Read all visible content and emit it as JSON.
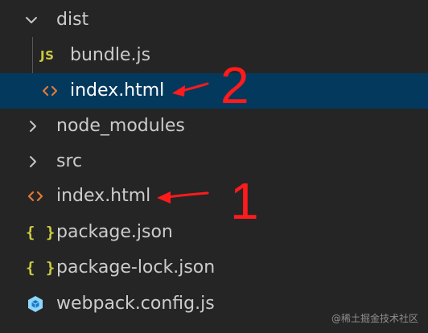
{
  "explorer": {
    "items": [
      {
        "label": "dist",
        "kind": "folder",
        "expanded": true,
        "icon": "chevron-down-icon"
      },
      {
        "label": "bundle.js",
        "kind": "file",
        "icon": "js-file-icon",
        "icon_text": "JS",
        "icon_color": "#cbcb41"
      },
      {
        "label": "index.html",
        "kind": "file",
        "icon": "html-file-icon",
        "icon_color": "#e37933",
        "selected": true
      },
      {
        "label": "node_modules",
        "kind": "folder",
        "expanded": false,
        "icon": "chevron-right-icon"
      },
      {
        "label": "src",
        "kind": "folder",
        "expanded": false,
        "icon": "chevron-right-icon"
      },
      {
        "label": "index.html",
        "kind": "file",
        "icon": "html-file-icon",
        "icon_color": "#e37933"
      },
      {
        "label": "package.json",
        "kind": "file",
        "icon": "json-file-icon",
        "icon_text": "{ }",
        "icon_color": "#cbcb41"
      },
      {
        "label": "package-lock.json",
        "kind": "file",
        "icon": "json-file-icon",
        "icon_text": "{ }",
        "icon_color": "#cbcb41"
      },
      {
        "label": "webpack.config.js",
        "kind": "file",
        "icon": "webpack-config-icon",
        "icon_color": "#8ed6fb"
      }
    ]
  },
  "annotations": {
    "marker_1": "1",
    "marker_2": "2",
    "color": "#ff1b1b"
  },
  "watermark": "@稀土掘金技术社区",
  "colors": {
    "background": "#252526",
    "selection": "#04395e",
    "text": "#cccccc"
  }
}
